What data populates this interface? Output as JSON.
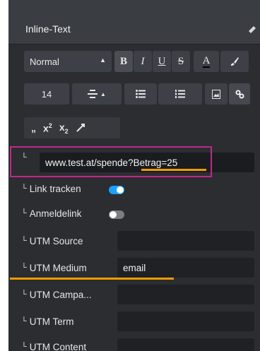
{
  "header": {
    "title": "Inline-Text"
  },
  "toolbar": {
    "block_format": "Normal",
    "bold": "B",
    "italic": "I",
    "underline": "U",
    "strike": "S",
    "text_color": "A",
    "font_size": "14",
    "superscript_base": "x",
    "superscript": "2",
    "subscript_base": "x",
    "subscript": "2"
  },
  "link": {
    "url_prefix": "www.test.at/spende?",
    "url_param": "Betrag=25",
    "track_label": "Link tracken",
    "track_on": true,
    "login_label": "Anmeldelink",
    "login_on": false
  },
  "utm": {
    "source_label": "UTM Source",
    "source_value": "",
    "medium_label": "UTM Medium",
    "medium_value": "email",
    "campaign_label": "UTM Campa...",
    "campaign_value": "",
    "term_label": "UTM Term",
    "term_value": "",
    "content_label": "UTM Content",
    "content_value": ""
  },
  "colors": {
    "accent_toggle": "#1aa0ff",
    "highlight_box": "#c0288c",
    "underline_marker": "#f29a00"
  }
}
